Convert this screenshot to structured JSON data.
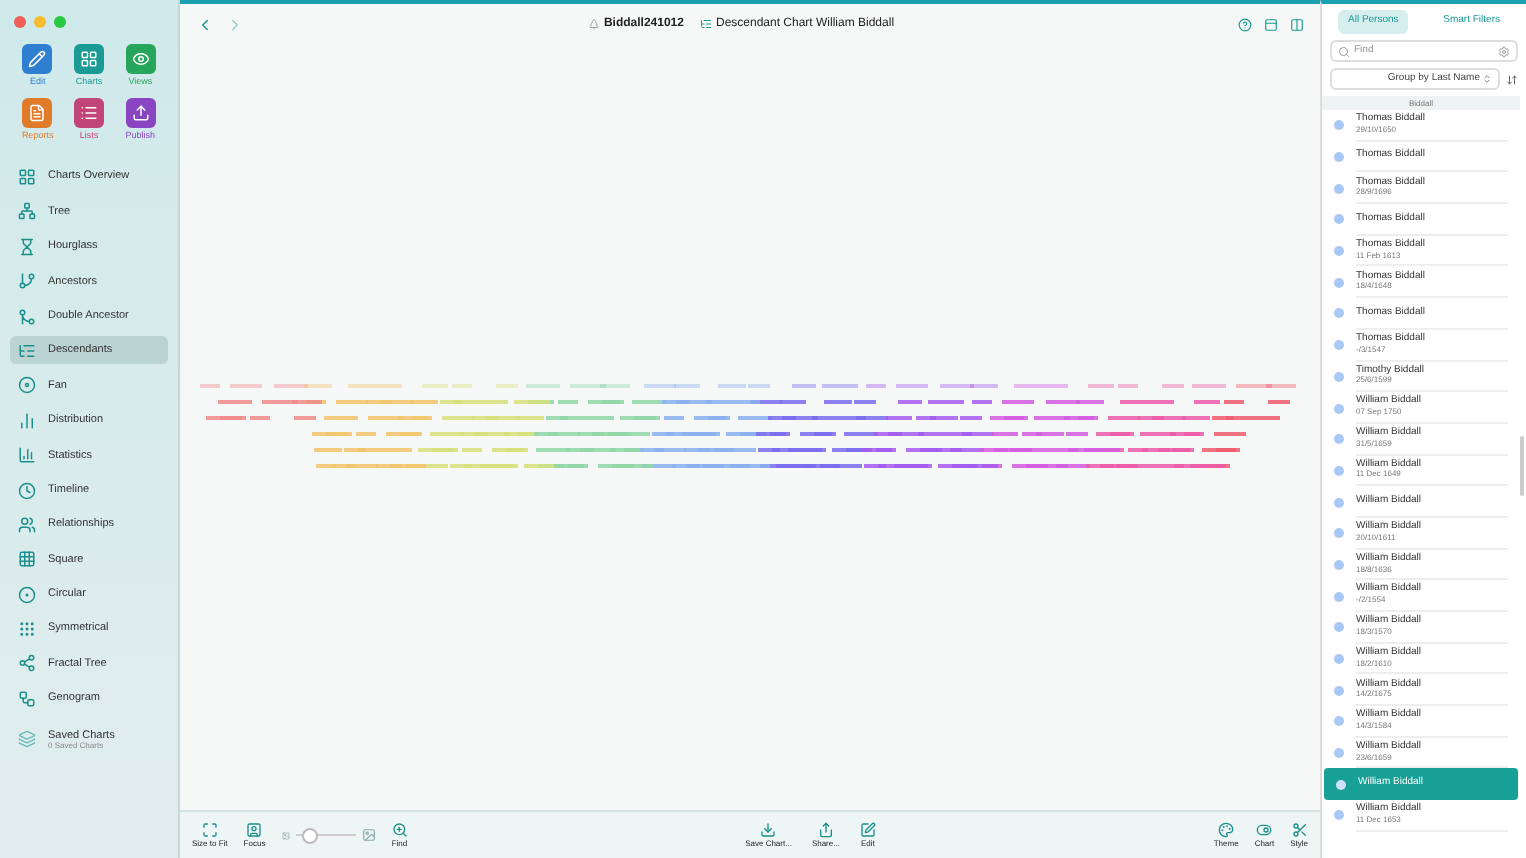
{
  "window": {
    "title_file": "Biddall241012",
    "title_chart": "Descendant Chart William Biddall"
  },
  "toolbar_top": [
    {
      "label": "Edit",
      "color": "#2f7fd1"
    },
    {
      "label": "Charts",
      "color": "#1a9a95"
    },
    {
      "label": "Views",
      "color": "#26a65b"
    },
    {
      "label": "Reports",
      "color": "#e07b2a"
    },
    {
      "label": "Lists",
      "color": "#c2457a"
    },
    {
      "label": "Publish",
      "color": "#8a45c2"
    }
  ],
  "sidebar": {
    "items": [
      {
        "label": "Charts Overview",
        "selected": false
      },
      {
        "label": "Tree",
        "selected": false
      },
      {
        "label": "Hourglass",
        "selected": false
      },
      {
        "label": "Ancestors",
        "selected": false
      },
      {
        "label": "Double Ancestor",
        "selected": false
      },
      {
        "label": "Descendants",
        "selected": true
      },
      {
        "label": "Fan",
        "selected": false
      },
      {
        "label": "Distribution",
        "selected": false
      },
      {
        "label": "Statistics",
        "selected": false
      },
      {
        "label": "Timeline",
        "selected": false
      },
      {
        "label": "Relationships",
        "selected": false
      },
      {
        "label": "Square",
        "selected": false
      },
      {
        "label": "Circular",
        "selected": false
      },
      {
        "label": "Symmetrical",
        "selected": false
      },
      {
        "label": "Fractal Tree",
        "selected": false
      },
      {
        "label": "Genogram",
        "selected": false
      }
    ],
    "saved": {
      "label": "Saved Charts",
      "sub": "0 Saved Charts"
    }
  },
  "bottom_toolbar": {
    "left": [
      "Size to Fit",
      "Focus"
    ],
    "zoom": {
      "level": 0.15
    },
    "find": "Find",
    "middle": [
      "Save Chart...",
      "Share...",
      "Edit"
    ],
    "right": [
      "Theme",
      "Chart",
      "Style"
    ]
  },
  "right_panel": {
    "tabs": [
      {
        "label": "All Persons",
        "selected": true
      },
      {
        "label": "Smart Filters",
        "selected": false
      }
    ],
    "search": {
      "placeholder": "Find"
    },
    "group_by": "Group by Last Name",
    "section": "Biddall",
    "persons": [
      {
        "name": "Thomas Biddall",
        "date": "29/10/1650",
        "selected": false
      },
      {
        "name": "Thomas Biddall",
        "selected": false
      },
      {
        "name": "Thomas Biddall",
        "date": "28/9/1696",
        "selected": false
      },
      {
        "name": "Thomas Biddall",
        "selected": false
      },
      {
        "name": "Thomas Biddall",
        "date": "11 Feb 1613",
        "selected": false
      },
      {
        "name": "Thomas Biddall",
        "date": "18/4/1648",
        "selected": false
      },
      {
        "name": "Thomas Biddall",
        "selected": false
      },
      {
        "name": "Thomas Biddall",
        "date": "-/3/1547",
        "selected": false
      },
      {
        "name": "Timothy Biddall",
        "date": "25/6/1599",
        "selected": false
      },
      {
        "name": "William Biddall",
        "date": "07 Sep 1750",
        "selected": false
      },
      {
        "name": "William Biddall",
        "date": "31/5/1659",
        "selected": false
      },
      {
        "name": "William Biddall",
        "date": "11 Dec 1649",
        "selected": false
      },
      {
        "name": "William Biddall",
        "selected": false
      },
      {
        "name": "William Biddall",
        "date": "20/10/1611",
        "selected": false
      },
      {
        "name": "William Biddall",
        "date": "18/8/1636",
        "selected": false
      },
      {
        "name": "William Biddall",
        "date": "-/2/1554",
        "selected": false
      },
      {
        "name": "William Biddall",
        "date": "18/3/1570",
        "selected": false
      },
      {
        "name": "William Biddall",
        "date": "18/2/1610",
        "selected": false
      },
      {
        "name": "William Biddall",
        "date": "14/2/1675",
        "selected": false
      },
      {
        "name": "William Biddall",
        "date": "14/3/1584",
        "selected": false
      },
      {
        "name": "William Biddall",
        "date": "23/6/1659",
        "selected": false
      },
      {
        "name": "William Biddall",
        "selected": true
      },
      {
        "name": "William Biddall",
        "date": "11 Dec 1653",
        "selected": false
      }
    ]
  }
}
